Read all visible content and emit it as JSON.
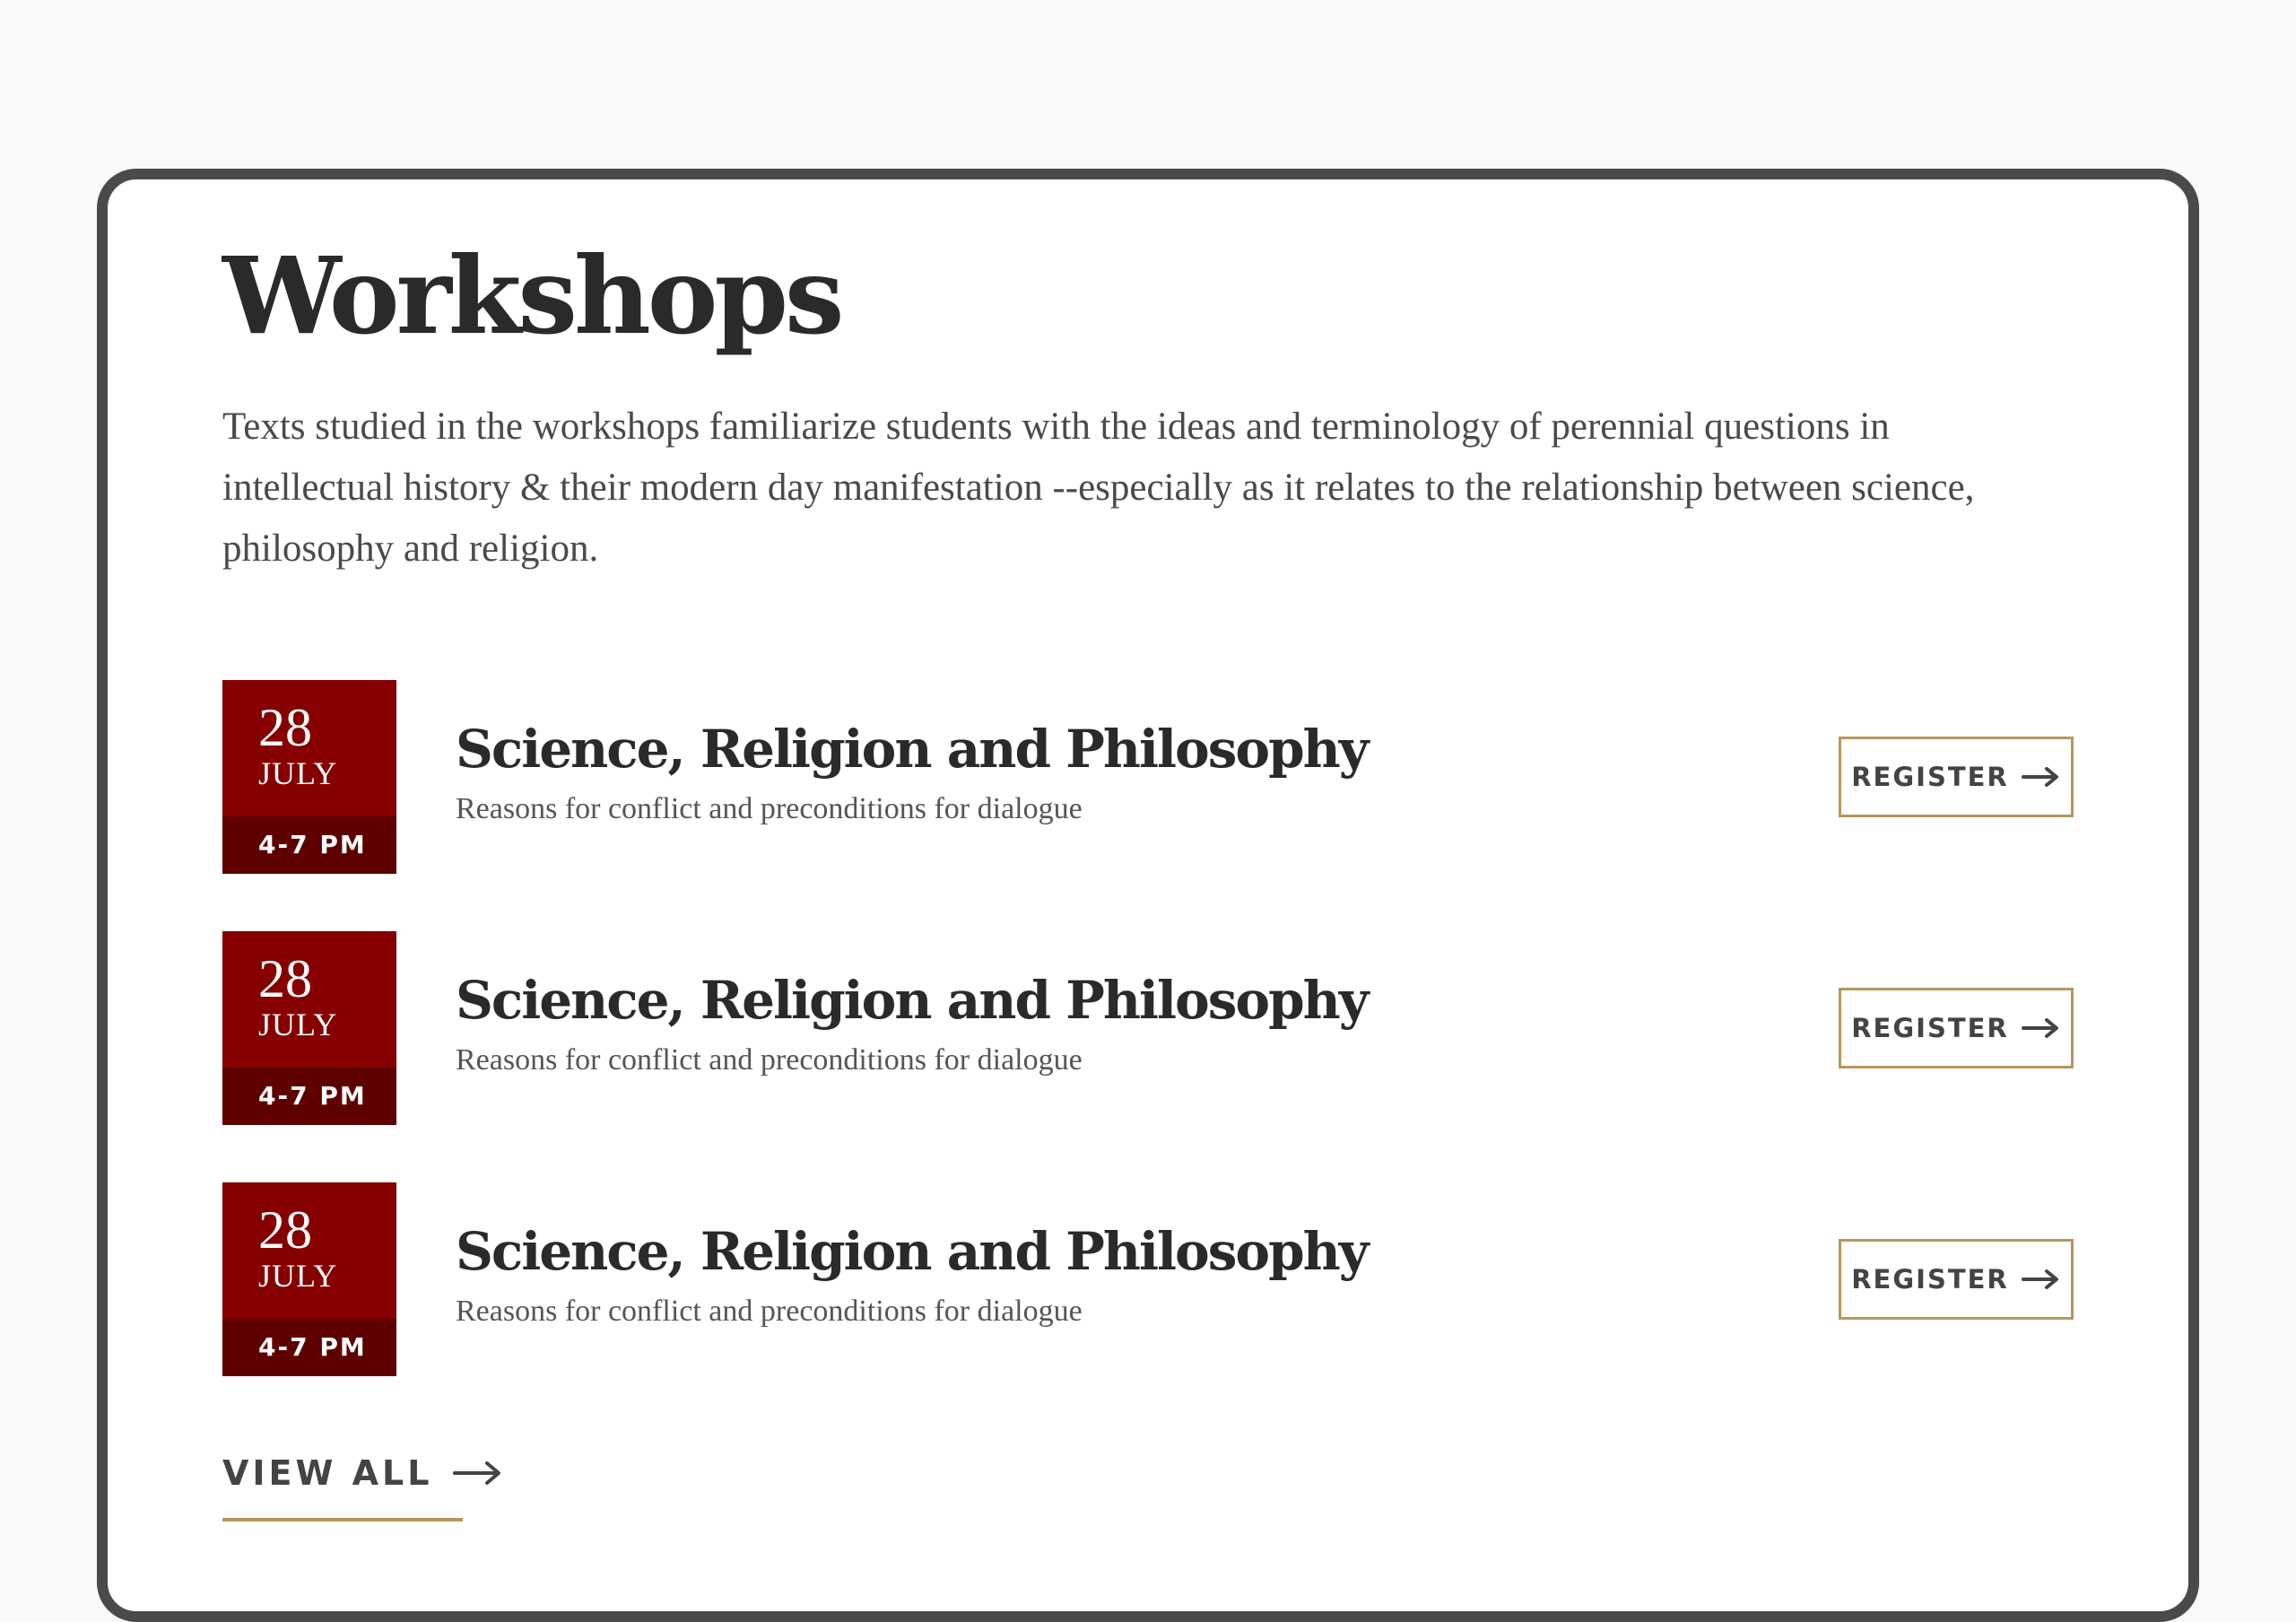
{
  "section": {
    "title": "Workshops",
    "intro": "Texts studied in the workshops familiarize students with the ideas and terminology of perennial questions in intellectual history & their modern day manifestation --especially as it relates to the relationship between science, philosophy and religion."
  },
  "events": [
    {
      "day": "28",
      "month": "JULY",
      "time": "4-7 PM",
      "title": "Science, Religion and Philosophy",
      "subtitle": "Reasons for conflict and preconditions for dialogue",
      "button_label": "REGISTER",
      "button_icon": "arrow-right-icon"
    },
    {
      "day": "28",
      "month": "JULY",
      "time": "4-7 PM",
      "title": "Science, Religion and Philosophy",
      "subtitle": "Reasons for conflict and preconditions for dialogue",
      "button_label": "REGISTER",
      "button_icon": "arrow-right-icon"
    },
    {
      "day": "28",
      "month": "JULY",
      "time": "4-7 PM",
      "title": "Science, Religion and Philosophy",
      "subtitle": "Reasons for conflict and preconditions for dialogue",
      "button_label": "REGISTER",
      "button_icon": "arrow-right-icon"
    }
  ],
  "view_all": {
    "label": "VIEW ALL",
    "icon": "arrow-right-icon"
  },
  "colors": {
    "page_background": "#f8f9fb",
    "frame_border": "#4a4a4a",
    "date_box": "#860000",
    "date_time_band": "#5e0000",
    "accent_gold": "#b6975f",
    "heading_text": "#2a2a2a",
    "body_text": "#4a4a4a"
  }
}
